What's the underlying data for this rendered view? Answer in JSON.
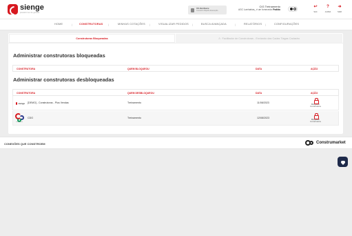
{
  "header": {
    "logo_text": "sienge",
    "logo_subtitle": "plataforma de gestão",
    "environment": {
      "title": "Ult.Hardware",
      "subtitle": "Contexto Rápido Execução"
    },
    "user": {
      "name": "CIG Treinamento",
      "company_prefix": "AGC Luminárias_ é um fornecedor",
      "company_highlight": "Podido"
    },
    "actions": [
      {
        "label": "SAC",
        "glyph": "↩"
      },
      {
        "label": "AJUDA",
        "glyph": "?"
      },
      {
        "label": "SAIR",
        "glyph": "➜"
      }
    ]
  },
  "nav": {
    "items": [
      {
        "label": "HOME"
      },
      {
        "label": "CONSTRUTORAS"
      },
      {
        "label": "MINHAS COTAÇÕES"
      },
      {
        "label": "VISUALIZAR PEDIDOS"
      },
      {
        "label": "BUSCA AVANÇADA"
      },
      {
        "label": "RELATÓRIOS"
      },
      {
        "label": "CONFIGURAÇÕES"
      }
    ]
  },
  "tabs": {
    "active": "Construtoras Bloqueadas",
    "inactive": "Facilitador de Construtoras - Enviando das Cadas Tiagas Cadastro"
  },
  "blocked_section": {
    "title": "Administrar construtoras bloqueadas",
    "columns": {
      "builder": "CONSTRUTORA",
      "who": "QUEM BLOQUEOU",
      "date": "DATA",
      "action": "AÇÃO"
    }
  },
  "unblocked_section": {
    "title": "Administrar construtoras desbloqueadas",
    "columns": {
      "builder": "CONSTRUTORA",
      "who": "QUEM DESBLOQUEOU",
      "date": "DATA",
      "action": "AÇÃO"
    },
    "rows": [
      {
        "logo_text": "sienge",
        "builder": "[DEMO] - Construtoras - Plus Vendas",
        "who": "Treinamento",
        "date": "11/08/2023",
        "action_line1": "Bloquear",
        "action_line2": "Construtora"
      },
      {
        "logo_text": "construtora",
        "builder": "CDG",
        "who": "Treinamento",
        "date": "12/08/2023",
        "action_line1": "Bloquear",
        "action_line2": "Construtora"
      }
    ]
  },
  "footer": {
    "text": "CONEXÕES QUE CONSTROEM",
    "brand": "Construmarket"
  },
  "colors": {
    "accent": "#d71920",
    "background": "#ededed",
    "fab": "#1e2a4a"
  }
}
